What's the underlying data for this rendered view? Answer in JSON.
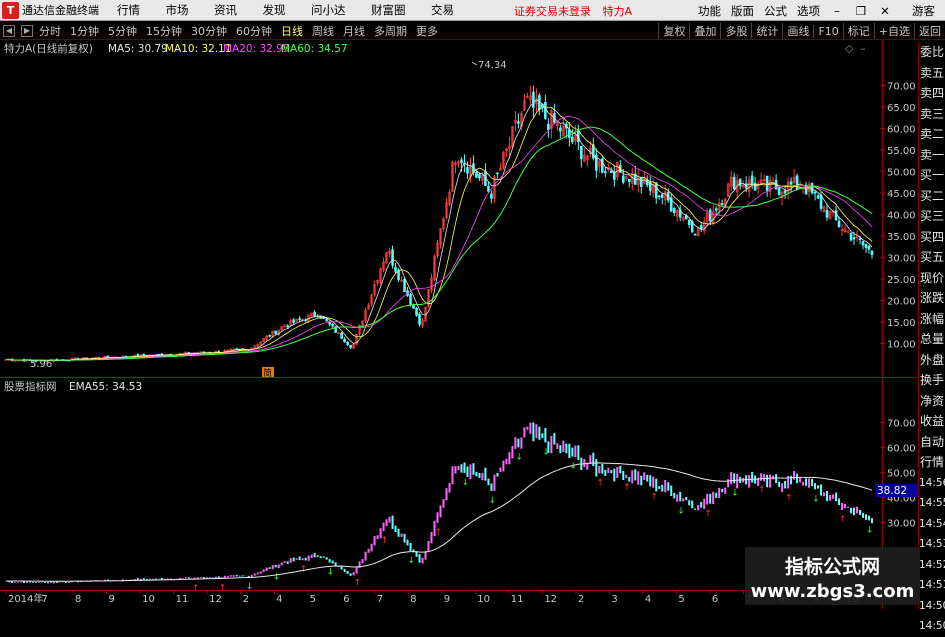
{
  "menubar": {
    "app_name": "通达信金融终端",
    "menu": [
      "行情",
      "市场",
      "资讯",
      "发现",
      "问小达",
      "财富圈",
      "交易"
    ],
    "trade_hint": "证券交易未登录",
    "stock_title": "特力A",
    "right_menu": [
      "功能",
      "版面",
      "公式",
      "选项"
    ],
    "guest": "游客"
  },
  "periodbar": {
    "periods": [
      "分时",
      "1分钟",
      "5分钟",
      "15分钟",
      "30分钟",
      "60分钟",
      "日线",
      "周线",
      "月线",
      "多周期",
      "更多"
    ],
    "active_period": "日线",
    "tools": [
      "复权",
      "叠加",
      "多股",
      "统计",
      "画线",
      "F10",
      "标记",
      "+自选",
      "返回"
    ]
  },
  "main_panel": {
    "title": "特力A(日线前复权)",
    "ma": [
      {
        "label": "MA5: 30.79",
        "color": "#e8e8e8"
      },
      {
        "label": "MA10: 32.11",
        "color": "#ffff54"
      },
      {
        "label": "MA20: 32.95",
        "color": "#ff44ff"
      },
      {
        "label": "MA60: 34.57",
        "color": "#44ff44"
      }
    ],
    "high_label": "74.34",
    "low_label": "5.96",
    "y_ticks": [
      "70.00",
      "65.00",
      "60.00",
      "55.00",
      "50.00",
      "45.00",
      "40.00",
      "35.00",
      "30.00",
      "25.00",
      "20.00",
      "15.00",
      "10.00"
    ],
    "marker": "简"
  },
  "sub_panel": {
    "title": "股票指标网",
    "ema": "EMA55: 34.53",
    "y_ticks": [
      "70.00",
      "60.00",
      "50.00",
      "40.00",
      "30.00"
    ],
    "current_value": "38.82"
  },
  "x_axis": {
    "labels": [
      "2014年",
      "7",
      "8",
      "9",
      "10",
      "11",
      "12",
      "2",
      "4",
      "5",
      "6",
      "7",
      "8",
      "9",
      "10",
      "11",
      "12",
      "2",
      "3",
      "4",
      "5",
      "6",
      "7",
      "8",
      "9",
      "10"
    ]
  },
  "side_panel": {
    "items": [
      "委比",
      "卖五",
      "卖四",
      "卖三",
      "卖二",
      "卖一",
      "买一",
      "买二",
      "买三",
      "买四",
      "买五",
      "现价",
      "涨跌",
      "涨幅",
      "总量",
      "外盘",
      "换手",
      "净资",
      "收益",
      "自动",
      "行情",
      "14:56",
      "14:55",
      "14:54",
      "14:53",
      "14:52",
      "14:51",
      "14:50",
      "14:50"
    ]
  },
  "watermark": {
    "line1": "指标公式网",
    "line2": "www.zbgs3.com"
  },
  "chart_data": {
    "type": "candlestick",
    "title": "特力A(日线前复权)",
    "x_labels": [
      "2014年",
      "7",
      "8",
      "9",
      "10",
      "11",
      "12",
      "2",
      "4",
      "5",
      "6",
      "7",
      "8",
      "9",
      "10",
      "11",
      "12",
      "2",
      "3",
      "4",
      "5",
      "6",
      "7",
      "8",
      "9",
      "10"
    ],
    "close_path": [
      {
        "x": "2014年",
        "y": 6.3
      },
      {
        "x": "7",
        "y": 6.0
      },
      {
        "x": "8",
        "y": 6.4
      },
      {
        "x": "9",
        "y": 6.8
      },
      {
        "x": "10",
        "y": 7.2
      },
      {
        "x": "11",
        "y": 7.6
      },
      {
        "x": "12",
        "y": 8.0
      },
      {
        "x": "2",
        "y": 8.6
      },
      {
        "x": "4",
        "y": 14.0
      },
      {
        "x": "5",
        "y": 17.0
      },
      {
        "x": "6",
        "y": 9.0
      },
      {
        "x": "7",
        "y": 32.0
      },
      {
        "x": "8",
        "y": 14.0
      },
      {
        "x": "9",
        "y": 55.0
      },
      {
        "x": "10",
        "y": 45.0
      },
      {
        "x": "11",
        "y": 66.0
      },
      {
        "x": "12",
        "y": 60.0
      },
      {
        "x": "2",
        "y": 52.0
      },
      {
        "x": "3",
        "y": 49.0
      },
      {
        "x": "4",
        "y": 44.0
      },
      {
        "x": "5",
        "y": 36.0
      },
      {
        "x": "6",
        "y": 48.0
      },
      {
        "x": "7",
        "y": 46.0
      },
      {
        "x": "8",
        "y": 47.0
      },
      {
        "x": "9",
        "y": 38.0
      },
      {
        "x": "10",
        "y": 31.0
      }
    ],
    "ma60_path": [
      {
        "x": "2014年",
        "y": 6.5
      },
      {
        "x": "12",
        "y": 7.5
      },
      {
        "x": "4",
        "y": 10.5
      },
      {
        "x": "6",
        "y": 14.0
      },
      {
        "x": "8",
        "y": 18.0
      },
      {
        "x": "9",
        "y": 25.0
      },
      {
        "x": "11",
        "y": 45.0
      },
      {
        "x": "12",
        "y": 56.0
      },
      {
        "x": "2",
        "y": 55.0
      },
      {
        "x": "4",
        "y": 44.0
      },
      {
        "x": "6",
        "y": 43.0
      },
      {
        "x": "8",
        "y": 46.0
      },
      {
        "x": "9",
        "y": 41.0
      },
      {
        "x": "10",
        "y": 35.0
      }
    ],
    "ylim": [
      5,
      75
    ],
    "y_ticks": [
      70,
      65,
      60,
      55,
      50,
      45,
      40,
      35,
      30,
      25,
      20,
      15,
      10
    ],
    "series": [
      {
        "name": "MA5",
        "color": "#e8e8e8"
      },
      {
        "name": "MA10",
        "color": "#ffff54"
      },
      {
        "name": "MA20",
        "color": "#ff44ff"
      },
      {
        "name": "MA60",
        "color": "#44ff44"
      }
    ]
  }
}
